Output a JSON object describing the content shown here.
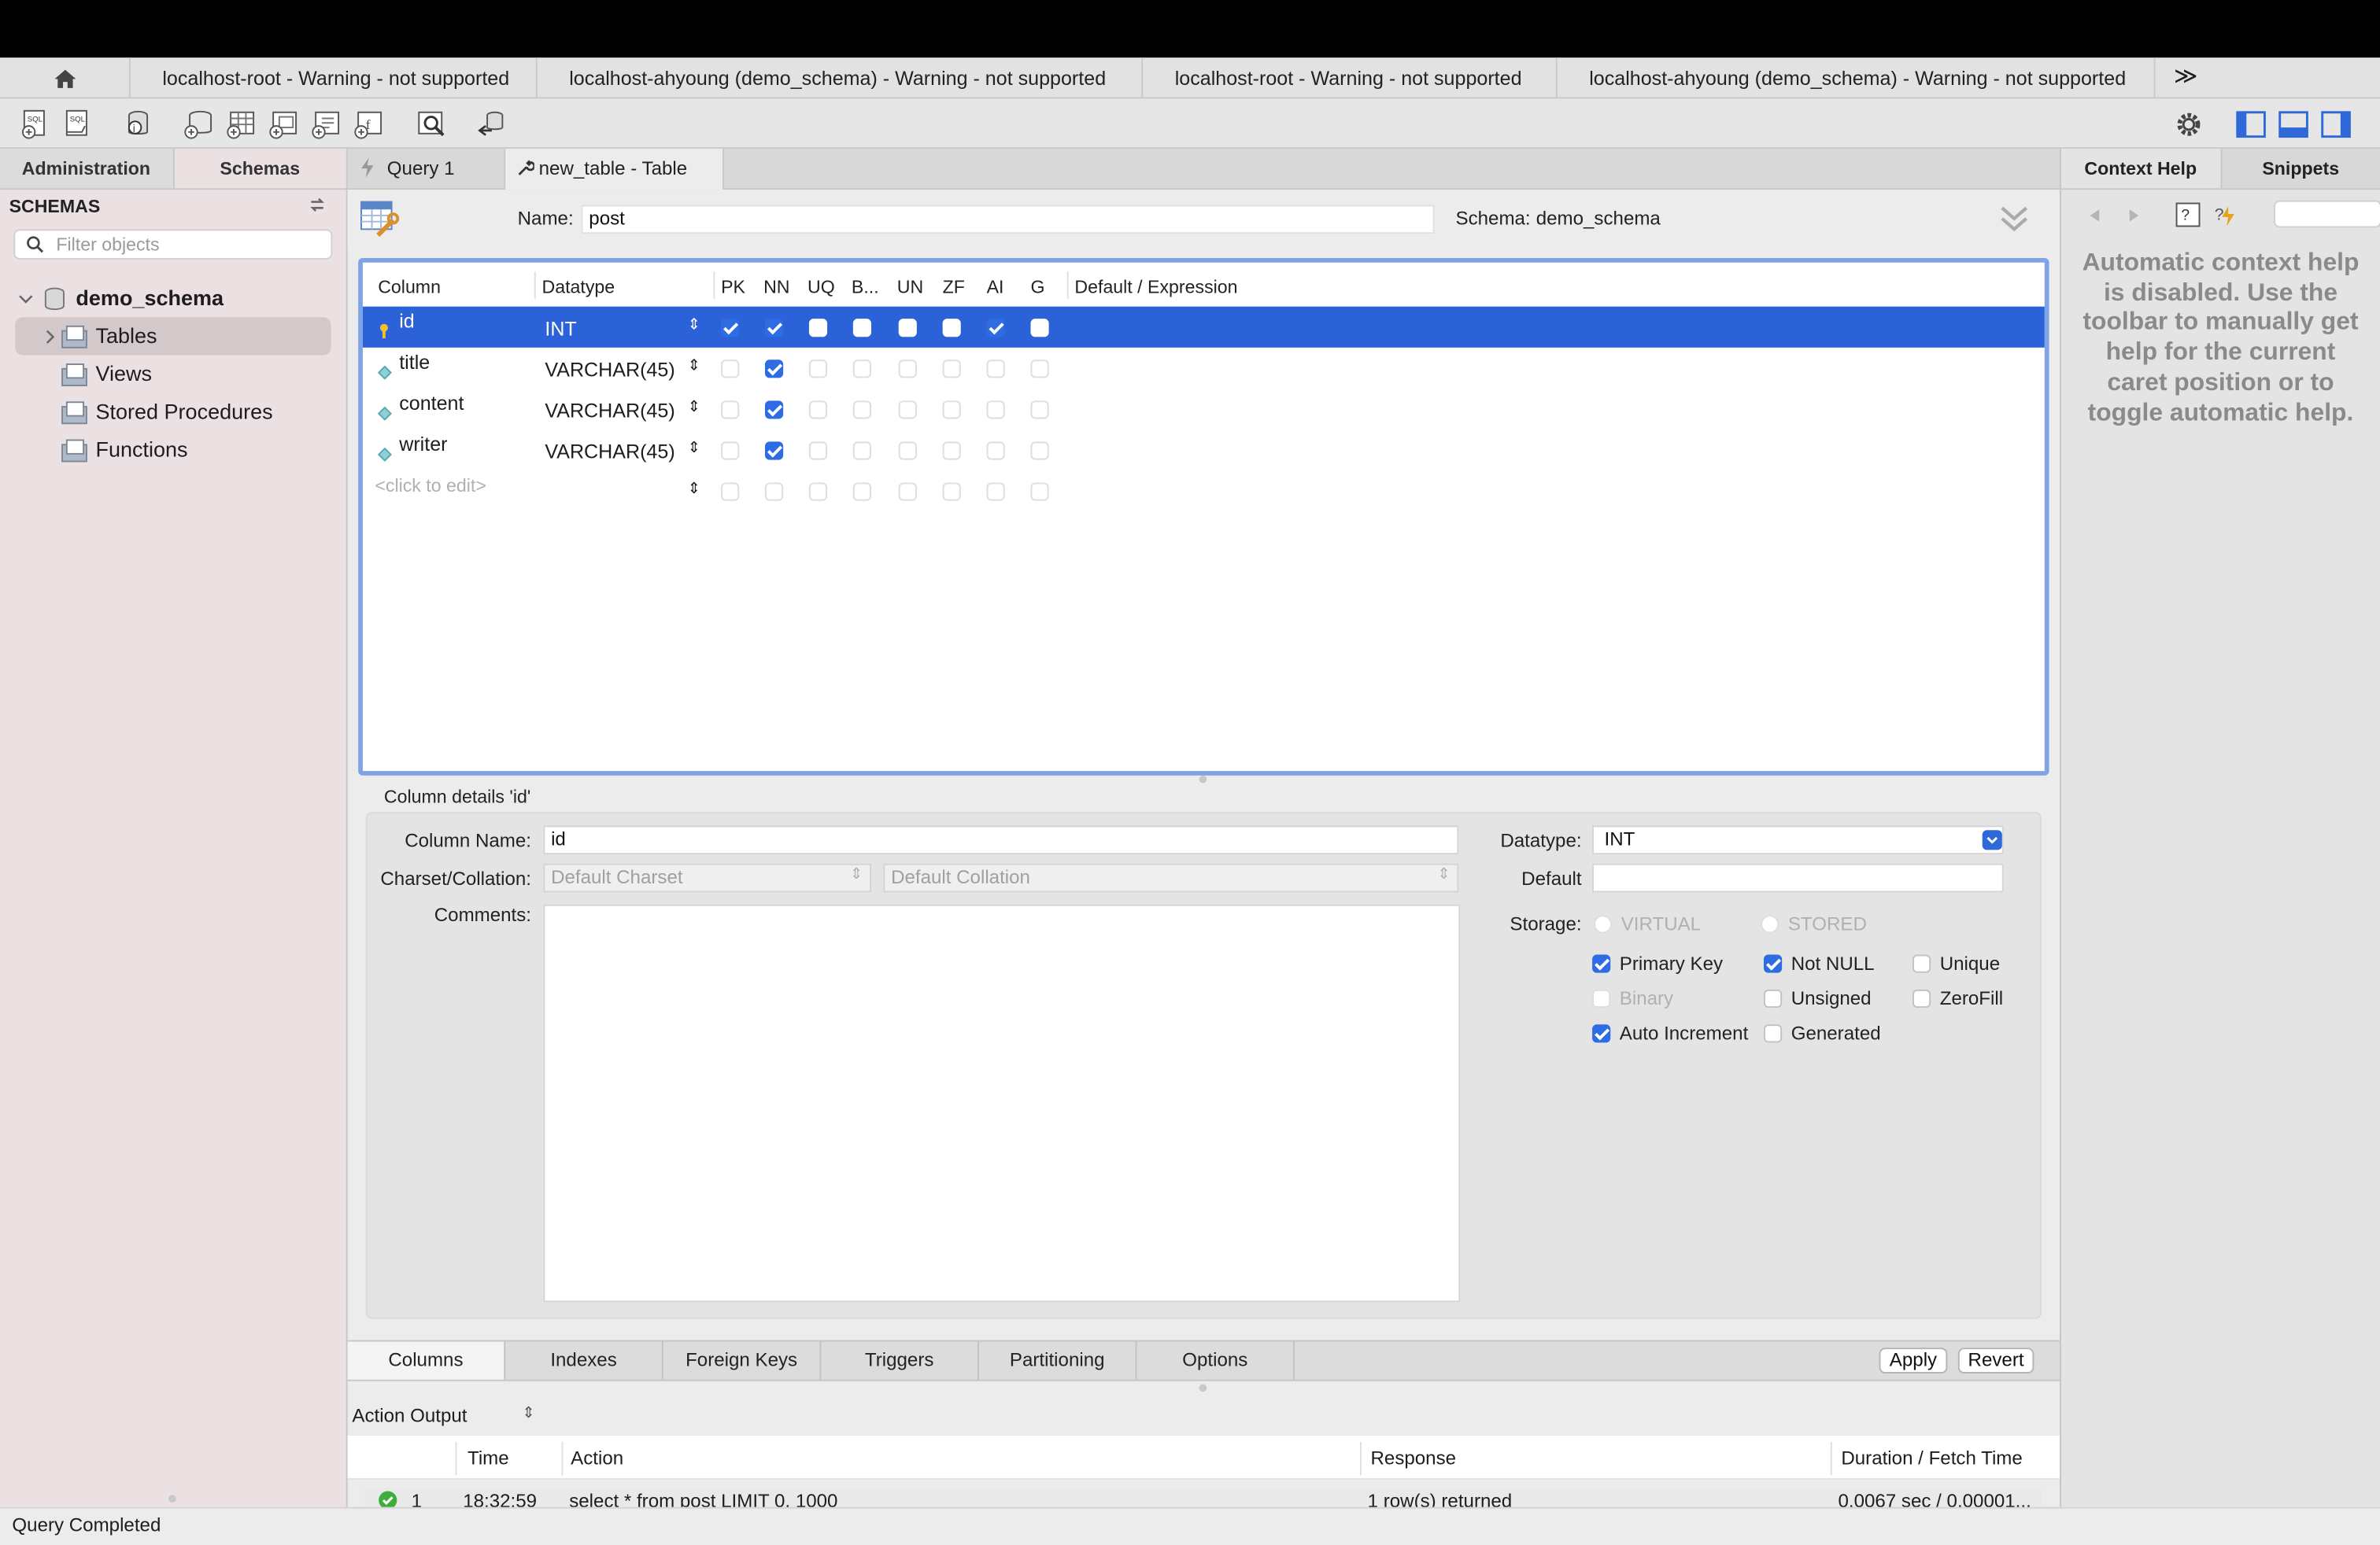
{
  "connection_tabs": [
    "localhost-root - Warning - not supported",
    "localhost-ahyoung (demo_schema) - Warning - not supported",
    "localhost-root - Warning - not supported",
    "localhost-ahyoung (demo_schema) - Warning - not supported"
  ],
  "more_tabs_label": "≫",
  "sidebar": {
    "tabs": [
      "Administration",
      "Schemas"
    ],
    "title": "SCHEMAS",
    "filter_placeholder": "Filter objects",
    "schema": "demo_schema",
    "items": [
      "Tables",
      "Views",
      "Stored Procedures",
      "Functions"
    ]
  },
  "editor_tabs": [
    "Query 1",
    "new_table - Table"
  ],
  "table_editor": {
    "name_label": "Name:",
    "name_value": "post",
    "schema_label": "Schema:",
    "schema_value": "demo_schema"
  },
  "grid": {
    "headers": [
      "Column",
      "Datatype",
      "PK",
      "NN",
      "UQ",
      "B...",
      "UN",
      "ZF",
      "AI",
      "G",
      "Default / Expression"
    ],
    "rows": [
      {
        "name": "id",
        "type": "INT",
        "flags": [
          true,
          true,
          false,
          false,
          false,
          false,
          true,
          false
        ],
        "selected": true,
        "key": true
      },
      {
        "name": "title",
        "type": "VARCHAR(45)",
        "flags": [
          false,
          true,
          false,
          false,
          false,
          false,
          false,
          false
        ]
      },
      {
        "name": "content",
        "type": "VARCHAR(45)",
        "flags": [
          false,
          true,
          false,
          false,
          false,
          false,
          false,
          false
        ]
      },
      {
        "name": "writer",
        "type": "VARCHAR(45)",
        "flags": [
          false,
          true,
          false,
          false,
          false,
          false,
          false,
          false
        ]
      }
    ],
    "new_row_placeholder": "<click to edit>"
  },
  "column_details": {
    "title": "Column details 'id'",
    "column_name_label": "Column Name:",
    "column_name_value": "id",
    "charset_label": "Charset/Collation:",
    "charset_value": "Default Charset",
    "collation_value": "Default Collation",
    "comments_label": "Comments:",
    "datatype_label": "Datatype:",
    "datatype_value": "INT",
    "default_label": "Default",
    "storage_label": "Storage:",
    "storage_virtual": "VIRTUAL",
    "storage_stored": "STORED",
    "options": {
      "primary_key": "Primary Key",
      "not_null": "Not NULL",
      "unique": "Unique",
      "binary": "Binary",
      "unsigned": "Unsigned",
      "zerofill": "ZeroFill",
      "auto_increment": "Auto Increment",
      "generated": "Generated"
    }
  },
  "bottom_tabs": [
    "Columns",
    "Indexes",
    "Foreign Keys",
    "Triggers",
    "Partitioning",
    "Options"
  ],
  "buttons": {
    "apply": "Apply",
    "revert": "Revert"
  },
  "output": {
    "selector": "Action Output",
    "headers": [
      "Time",
      "Action",
      "Response",
      "Duration / Fetch Time"
    ],
    "row": {
      "index": "1",
      "time": "18:32:59",
      "action": "select * from post LIMIT 0, 1000",
      "response": "1 row(s) returned",
      "duration": "0.0067 sec / 0.00001..."
    }
  },
  "status": "Query Completed",
  "right_panel": {
    "tabs": [
      "Context Help",
      "Snippets"
    ],
    "help_text": "Automatic context help is disabled. Use the toolbar to manually get help for the current caret position or to toggle automatic help."
  },
  "colors": {
    "selection": "#2c62d8",
    "checkbox": "#2d6ce3",
    "grid_border": "#7ea4e6"
  },
  "icons": [
    "home-icon",
    "new-sql-tab-icon",
    "open-sql-script-icon",
    "inspector-icon",
    "create-schema-icon",
    "create-table-icon",
    "create-view-icon",
    "create-procedure-icon",
    "create-function-icon",
    "search-table-data-icon",
    "reconnect-icon",
    "settings-icon",
    "toggle-sidebar-icon",
    "toggle-output-icon",
    "toggle-secondary-sidebar-icon"
  ]
}
